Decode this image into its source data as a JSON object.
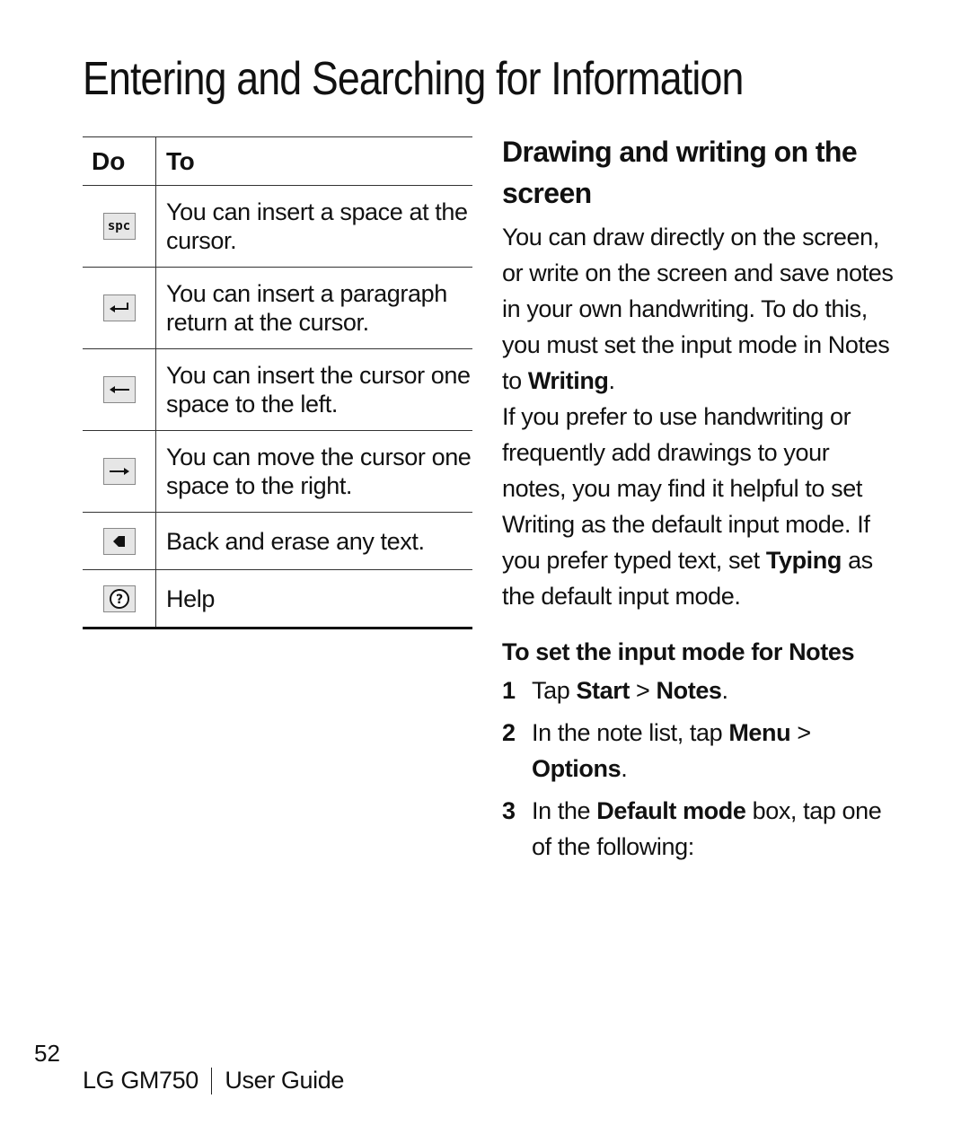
{
  "page": {
    "title": "Entering and Searching for Information",
    "page_number": "52",
    "footer_model": "LG GM750",
    "footer_doc": "User Guide"
  },
  "table": {
    "headers": {
      "do": "Do",
      "to": "To"
    },
    "rows": [
      {
        "icon": "space-key-icon",
        "icon_label": "spc",
        "text": "You can insert a space at the cursor."
      },
      {
        "icon": "enter-key-icon",
        "text": "You can insert a paragraph return at the cursor."
      },
      {
        "icon": "left-arrow-key-icon",
        "text": "You can insert the cursor one space to the left."
      },
      {
        "icon": "right-arrow-key-icon",
        "text": "You can move the cursor one space to the right."
      },
      {
        "icon": "backspace-key-icon",
        "text": "Back and erase any text."
      },
      {
        "icon": "help-key-icon",
        "text": "Help"
      }
    ]
  },
  "section": {
    "title": "Drawing and writing on the screen",
    "para1_text": "You can draw directly on the screen, or write on the screen and save notes in your own handwriting. To do this, you must set the input mode in Notes to ",
    "para1_bold": "Writing",
    "para1_end": ".",
    "para2_text": "If you prefer to use handwriting or frequently add drawings to your notes, you may find it helpful to set Writing as the default input mode. If you prefer typed text, set ",
    "para2_bold": "Typing",
    "para2_end": " as the default input mode.",
    "procedure_title": "To set the input mode for Notes",
    "steps": [
      {
        "num": "1",
        "pre": "Tap ",
        "b1": "Start",
        "mid": " > ",
        "b2": "Notes",
        "post": "."
      },
      {
        "num": "2",
        "pre": "In the note list, tap ",
        "b1": "Menu",
        "mid": " > ",
        "b2": "Options",
        "post": "."
      },
      {
        "num": "3",
        "pre": "In the ",
        "b1": "Default mode",
        "mid": " box, tap one of the following:"
      }
    ]
  }
}
